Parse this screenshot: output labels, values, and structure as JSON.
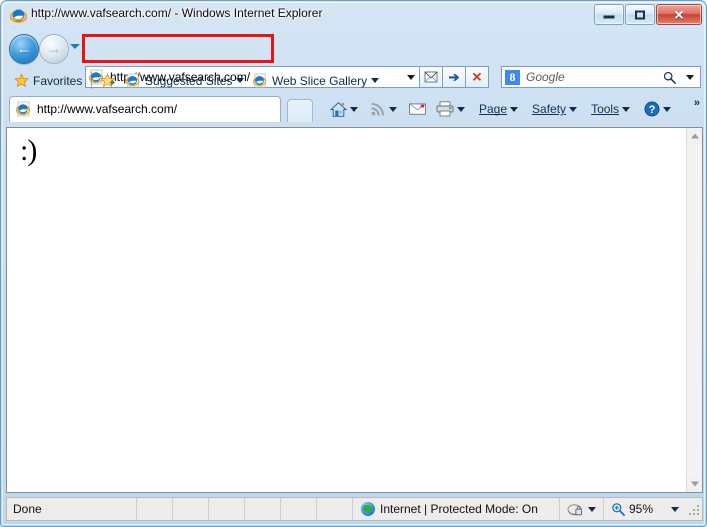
{
  "window": {
    "title": "http://www.vafsearch.com/ - Windows Internet Explorer",
    "app_icon": "internet-explorer-icon",
    "controls": {
      "minimize": "Minimize",
      "maximize": "Maximize",
      "close": "Close",
      "close_glyph": "✕"
    },
    "accent_red": "#e81313",
    "frame_blue": "#c3dcf2"
  },
  "navigation": {
    "back_label": "Back",
    "back_glyph": "←",
    "forward_label": "Forward",
    "forward_glyph": "→",
    "recent_pages_label": "Recent Pages",
    "address": {
      "value": "http://www.vafsearch.com/",
      "placeholder": "http://www.vafsearch.com/",
      "favicon": "internet-explorer-icon",
      "dropdown_label": "Address dropdown"
    },
    "compatibility_glyph": "✉",
    "go_glyph": "➔",
    "stop_glyph": "✕",
    "search": {
      "placeholder": "Google",
      "provider_icon": "google-icon",
      "provider_glyph": "8",
      "magnifier": "search-icon",
      "dropdown_label": "Search provider dropdown"
    }
  },
  "favorites_bar": {
    "favorites_label": "Favorites",
    "favorites_icon": "star-icon",
    "add_favorite_icon": "add-favorite-icon",
    "items": [
      {
        "label": "Suggested Sites",
        "icon": "internet-explorer-icon",
        "has_dropdown": true
      },
      {
        "label": "Web Slice Gallery",
        "icon": "internet-explorer-icon",
        "has_dropdown": true
      }
    ]
  },
  "tabs": {
    "active": {
      "title": "http://www.vafsearch.com/",
      "favicon": "internet-explorer-icon"
    },
    "new_tab_label": "New Tab"
  },
  "command_bar": {
    "home_icon": "home-icon",
    "feeds_icon": "rss-feed-icon",
    "mail_icon": "mail-icon",
    "print_icon": "print-icon",
    "page_label": "Page",
    "safety_label": "Safety",
    "tools_label": "Tools",
    "help_icon": "help-icon",
    "overflow_glyph": "»"
  },
  "content": {
    "body_text": ":)"
  },
  "scrollbar": {
    "up_label": "Scroll up",
    "down_label": "Scroll down"
  },
  "status_bar": {
    "status_text": "Done",
    "zone_icon": "globe-icon",
    "zone_text": "Internet | Protected Mode: On",
    "privacy_icon": "privacy-report-icon",
    "zoom_icon": "zoom-icon",
    "zoom_level": "95%",
    "zoom_dropdown_label": "Change zoom level"
  }
}
